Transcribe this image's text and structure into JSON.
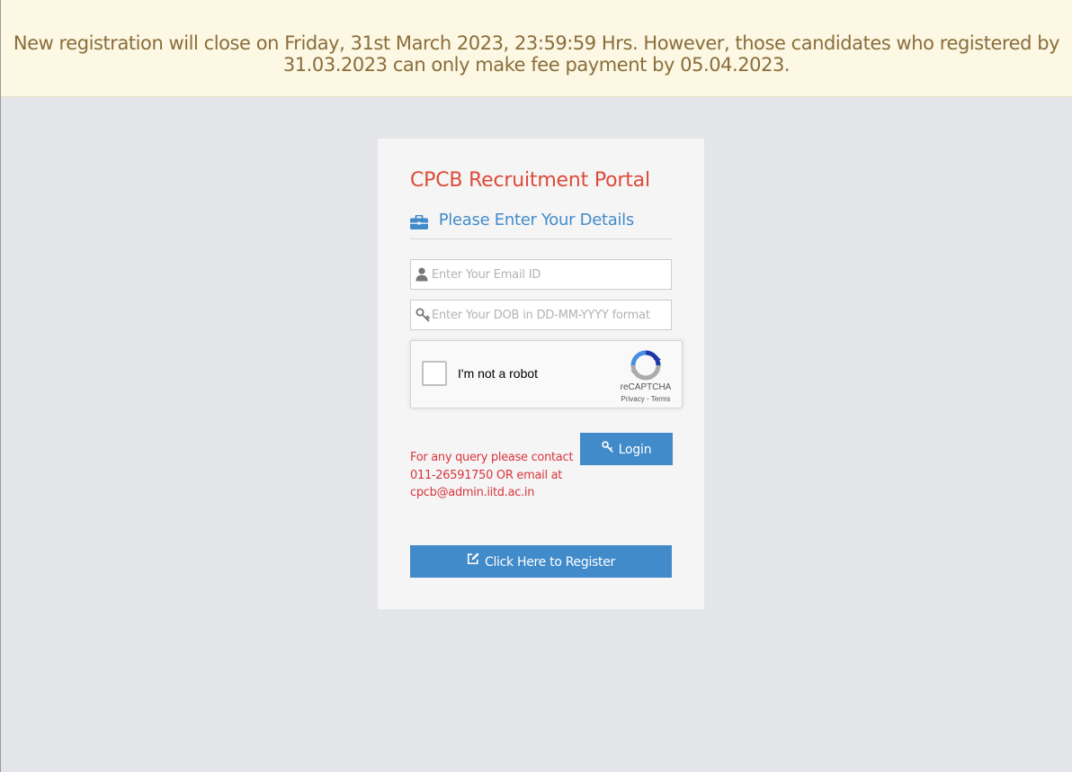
{
  "notice": {
    "line1": "New registration will close on Friday, 31st March 2023, 23:59:59 Hrs. However, those candidates who registered by",
    "line2": "31.03.2023 can only make fee payment by 05.04.2023."
  },
  "login": {
    "title": "CPCB Recruitment Portal",
    "subtitle": "Please Enter Your Details",
    "subtitle_icon": "briefcase-icon",
    "email_placeholder": "Enter Your Email ID",
    "email_icon": "user-icon",
    "dob_placeholder": "Enter Your DOB in DD-MM-YYYY format",
    "dob_icon": "key-icon",
    "recaptcha": {
      "label": "I'm not a robot",
      "brand": "reCAPTCHA",
      "privacy": "Privacy",
      "separator": " - ",
      "terms": "Terms"
    },
    "login_button": "Login",
    "query_text": "For any query please contact 011-26591750 OR email at cpcb@admin.iitd.ac.in",
    "register_button": "Click Here to Register",
    "register_icon": "edit-icon"
  },
  "colors": {
    "notice_bg": "#fcf8e3",
    "notice_text": "#8a6d3b",
    "title": "#dd4b39",
    "accent": "#428bca",
    "query_text": "#d9363e",
    "page_bg": "#e4e5e9",
    "card_bg": "#f5f5f5"
  }
}
